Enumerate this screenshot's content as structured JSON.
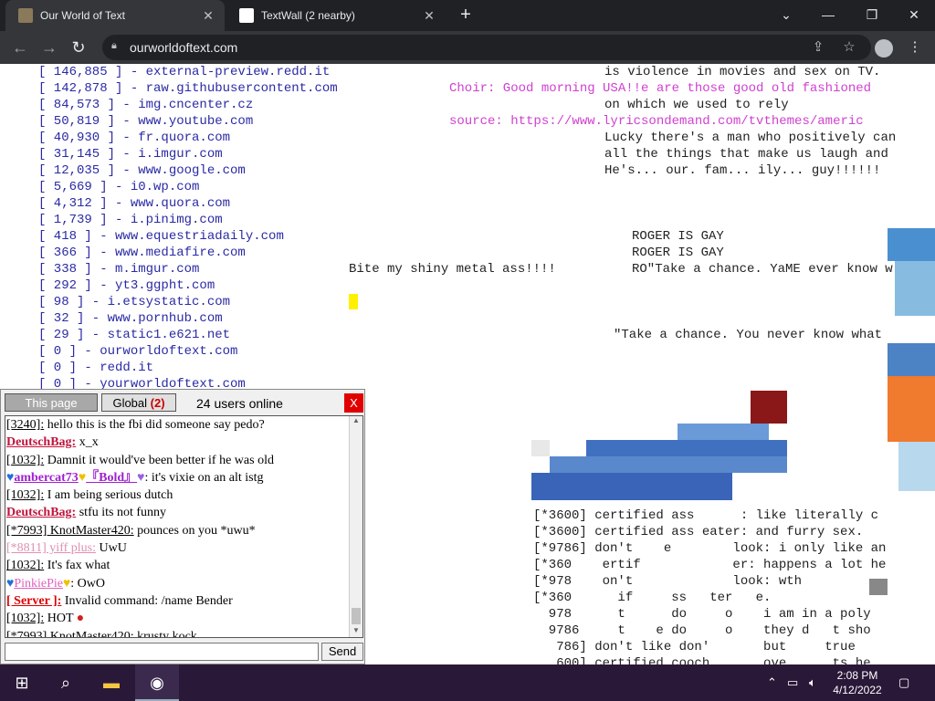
{
  "browser": {
    "tabs": [
      {
        "title": "Our World of Text",
        "active": true
      },
      {
        "title": "TextWall (2 nearby)",
        "active": false
      }
    ],
    "url": "ourworldoftext.com",
    "new_tab_glyph": "+",
    "window_controls": [
      "minimize",
      "restore",
      "close"
    ]
  },
  "world": {
    "stats": [
      "[ 146,885 ] - external-preview.redd.it",
      "[ 142,878 ] - raw.githubusercontent.com",
      "[ 84,573 ] - img.cncenter.cz",
      "[ 50,819 ] - www.youtube.com",
      "[ 40,930 ] - fr.quora.com",
      "[ 31,145 ] - i.imgur.com",
      "[ 12,035 ] - www.google.com",
      "[ 5,669 ] - i0.wp.com",
      "[ 4,312 ] - www.quora.com",
      "[ 1,739 ] - i.pinimg.com",
      "[ 418 ] - www.equestriadaily.com",
      "[ 366 ] - www.mediafire.com",
      "[ 338 ] - m.imgur.com",
      "[ 292 ] - yt3.ggpht.com",
      "[ 98 ] - i.etsystatic.com",
      "[ 32 ] - www.pornhub.com",
      "[ 29 ] - static1.e621.net",
      "[ 0 ] - ourworldoftext.com",
      "[ 0 ] - redd.it",
      "[ 0 ] - yourworldoftext.com"
    ],
    "right_text": [
      "is violence in movies and sex on TV.",
      "Choir: Good morning USA!!e are those good old fashioned",
      "on which we used to rely",
      "source: https://www.lyricsondemand.com/tvthemes/americ",
      "Lucky there's a man who positively can",
      "all the things that make us laugh and",
      "He's... our. fam... ily... guy!!!!!!"
    ],
    "middle_text": {
      "roger1": "ROGER IS GAY",
      "roger2": "ROGER IS GAY",
      "bite": "Bite my shiny metal ass!!!!",
      "ro": "RO\"Take a chance. YaME ever know w",
      "take": "\"Take a chance. You never know what"
    },
    "bottom_text": [
      "[*3600] certified ass      : like literally c",
      "[*3600] certified ass eater: and furry sex.",
      "[*9786] don't    e        look: i only like an",
      "[*360    ertif            er: happens a lot he",
      "[*978    on't             look: wth",
      "[*360      if     ss   ter   e.",
      "  978      t      do     o    i am in a poly",
      "  9786     t    e do     o    they d   t sho",
      "   786] don't like don'       but     true",
      "   600] certified cooch       ove      ts he"
    ]
  },
  "chat": {
    "tab_page": "This page",
    "tab_global": "Global",
    "global_badge": "(2)",
    "online": "24 users online",
    "close": "X",
    "send": "Send",
    "messages": [
      {
        "nick": "[3240]:",
        "text": " hello this is the fbi did someone say pedo?",
        "style": "u"
      },
      {
        "nick": "DeutschBag:",
        "text": " x_x",
        "style": "nick-red"
      },
      {
        "nick": "[1032]:",
        "text": " Damnit it would've been better if he was old",
        "style": "u"
      },
      {
        "nick": "ambercat73",
        "extra": "『Bold』",
        "text": ": it's vixie on an alt istg",
        "style": "nick-purple"
      },
      {
        "nick": "[1032]:",
        "text": " I am being serious dutch",
        "style": "u"
      },
      {
        "nick": "DeutschBag:",
        "text": " stfu its not funny",
        "style": "nick-red"
      },
      {
        "nick": "[*7993] KnotMaster420:",
        "text": " pounces on you *uwu*",
        "style": "u"
      },
      {
        "nick": "[*8811] yiff plus:",
        "text": " UwU",
        "style": "nick-faded"
      },
      {
        "nick": "[1032]:",
        "text": " It's fax what",
        "style": "u"
      },
      {
        "nick": "PinkiePie",
        "text": ": OwO",
        "style": "nick-pink"
      },
      {
        "nick": "[ Server ]:",
        "text": " Invalid command: /name Bender",
        "style": "server"
      },
      {
        "nick": "[1032]:",
        "text": " HOT",
        "style": "u"
      },
      {
        "nick": "[*7993] KnotMaster420:",
        "text": " krusty kock",
        "style": "u"
      }
    ]
  },
  "taskbar": {
    "time": "2:08 PM",
    "date": "4/12/2022",
    "apps": [
      "windows-start-icon",
      "search-icon",
      "file-explorer-icon",
      "chrome-icon"
    ]
  }
}
